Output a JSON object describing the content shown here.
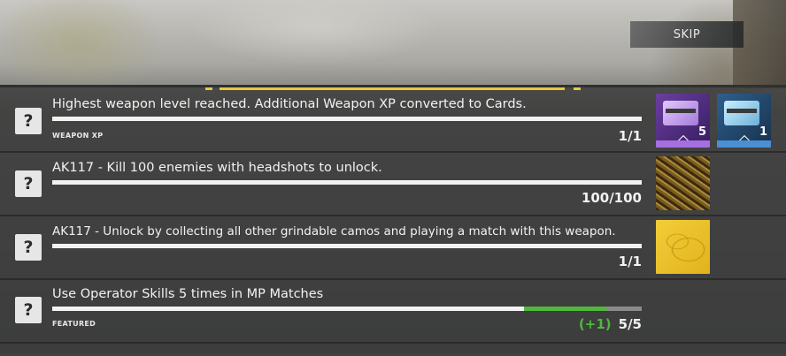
{
  "skip_label": "SKIP",
  "rows": [
    {
      "title": "Highest weapon level reached. Additional Weapon XP converted to Cards.",
      "tag": "WEAPON XP",
      "count": "1/1",
      "progress": 1.0,
      "rewards": [
        {
          "kind": "weapon-xp-card",
          "color": "#6b3fa0",
          "count": "5"
        },
        {
          "kind": "weapon-xp-card",
          "color": "#2e5f8f",
          "count": "1"
        }
      ]
    },
    {
      "title": "AK117 - Kill 100 enemies with headshots to unlock.",
      "tag": "",
      "count": "100/100",
      "progress": 1.0,
      "rewards": [
        {
          "kind": "camo-snakeskin"
        }
      ]
    },
    {
      "title": "AK117 - Unlock by collecting all other grindable camos and playing a match with this weapon.",
      "tag": "",
      "count": "1/1",
      "progress": 1.0,
      "rewards": [
        {
          "kind": "camo-gold"
        }
      ]
    },
    {
      "title": "Use Operator Skills 5 times in MP Matches",
      "tag": "FEATURED",
      "gain": "(+1)",
      "count": "5/5",
      "progress_before": 0.8,
      "progress": 1.0,
      "accent": "#4fb83d",
      "rewards": []
    }
  ],
  "icons": {
    "quest": "question-mark-icon"
  }
}
